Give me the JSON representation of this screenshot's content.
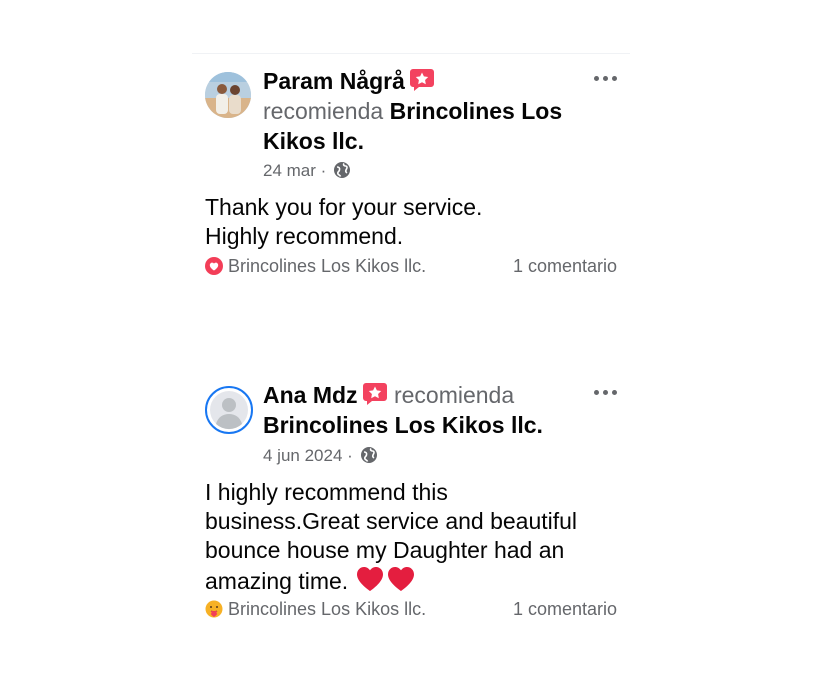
{
  "reviews": [
    {
      "author": "Param Någrå",
      "action": "recomienda",
      "page": "Brincolines Los Kikos llc.",
      "date": "24 mar",
      "separator": "·",
      "body_lines": [
        "Thank you for your service.",
        "Highly recommend."
      ],
      "reaction_by": "Brincolines Los Kikos llc.",
      "reaction_icon": "love-reaction-icon",
      "comments": "1 comentario"
    },
    {
      "author": "Ana Mdz",
      "action": "recomienda",
      "page": "Brincolines Los Kikos llc.",
      "date": "4 jun 2024",
      "separator": "·",
      "body_lines": [
        "I highly recommend this",
        "business.Great service and beautiful",
        "bounce house my Daughter had an",
        "amazing time."
      ],
      "reaction_by": "Brincolines Los Kikos llc.",
      "reaction_icon": "care-reaction-icon",
      "comments": "1 comentario"
    }
  ],
  "colors": {
    "primary_text": "#050505",
    "secondary_text": "#65676b",
    "recommend_badge": "#f3425f",
    "heart": "#e41e3f",
    "avatar_ring": "#1877f2"
  }
}
